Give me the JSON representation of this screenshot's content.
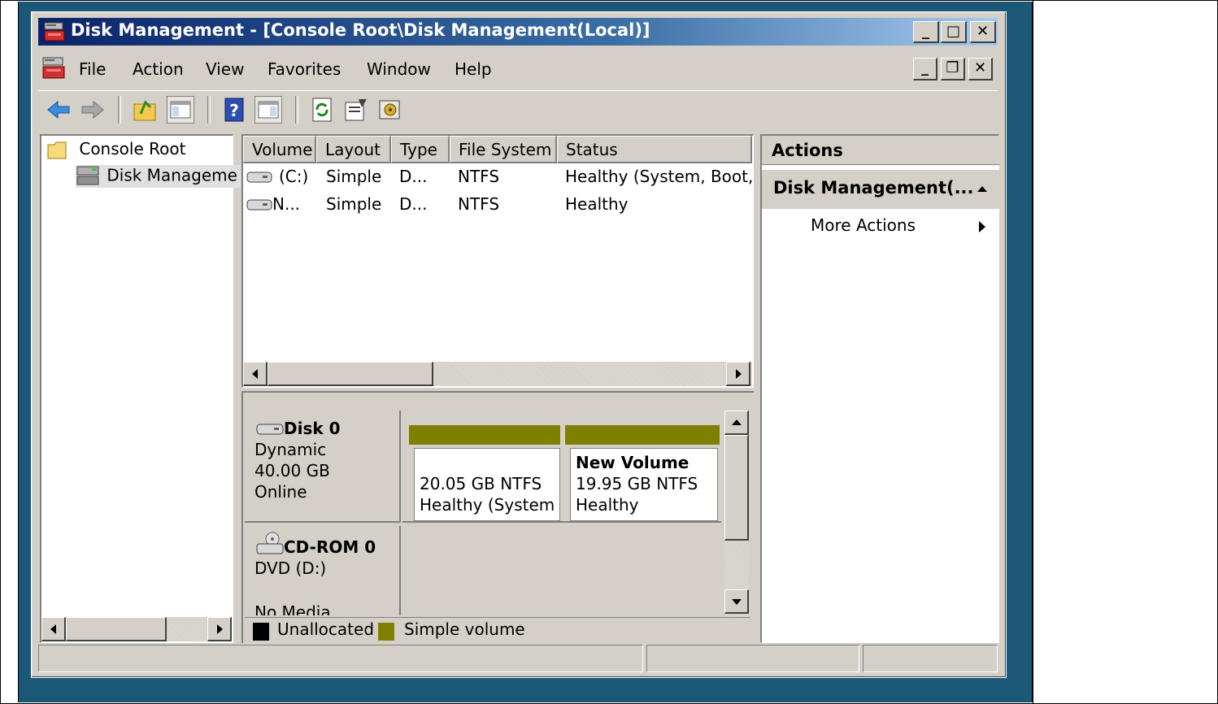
{
  "window": {
    "title": "Disk Management - [Console Root\\Disk Management(Local)]",
    "caption_buttons": {
      "minimize": "_",
      "maximize": "□",
      "close": "✕"
    },
    "mdi_buttons": {
      "minimize": "_",
      "restore": "❐",
      "close": "✕"
    }
  },
  "menu": {
    "items": [
      "File",
      "Action",
      "View",
      "Favorites",
      "Window",
      "Help"
    ]
  },
  "toolbar": {
    "icons": [
      "back-icon",
      "forward-icon",
      "up-folder-icon",
      "show-hide-tree-icon",
      "help-icon",
      "show-hide-action-pane-icon",
      "refresh-icon",
      "properties-icon",
      "disk-wizard-icon"
    ],
    "help_glyph": "?"
  },
  "tree": {
    "root": "Console Root",
    "child": "Disk Manageme"
  },
  "volume_list": {
    "columns": [
      "Volume",
      "Layout",
      "Type",
      "File System",
      "Status"
    ],
    "rows": [
      {
        "volume": "(C:)",
        "layout": "Simple",
        "type": "D...",
        "fs": "NTFS",
        "status": "Healthy (System, Boot,"
      },
      {
        "volume": "N...",
        "layout": "Simple",
        "type": "D...",
        "fs": "NTFS",
        "status": "Healthy"
      }
    ]
  },
  "disks": {
    "disk0": {
      "name": "Disk 0",
      "type": "Dynamic",
      "size": "40.00 GB",
      "state": "Online"
    },
    "partitions": [
      {
        "name": "",
        "size": "20.05 GB NTFS",
        "status": "Healthy (System,"
      },
      {
        "name": "New Volume",
        "size": "19.95 GB NTFS",
        "status": "Healthy"
      }
    ],
    "cdrom": {
      "name": "CD-ROM 0",
      "type": "DVD (D:)",
      "media": "No Media"
    }
  },
  "legend": {
    "unallocated": "Unallocated",
    "simple": "Simple volume",
    "unallocated_color": "#000000",
    "simple_color": "#808000"
  },
  "actions": {
    "header": "Actions",
    "section": "Disk Management(...",
    "more": "More Actions"
  },
  "colors": {
    "desktop": "#1b5877",
    "titlebar_start": "#0a246a",
    "face": "#d4d0c8"
  }
}
